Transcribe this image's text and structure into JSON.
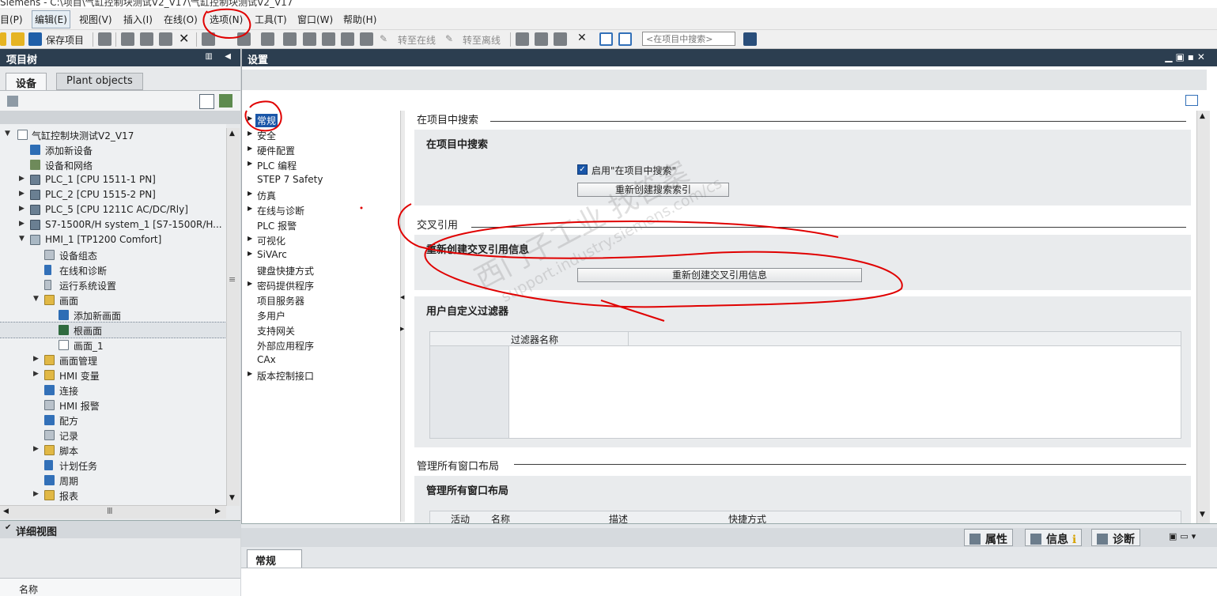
{
  "window": {
    "title": "Siemens - C:\\项目\\气缸控制块测试V2_V17\\气缸控制块测试V2_V17"
  },
  "menu": [
    "目(P)",
    "编辑(E)",
    "视图(V)",
    "插入(I)",
    "在线(O)",
    "选项(N)",
    "工具(T)",
    "窗口(W)",
    "帮助(H)"
  ],
  "toolbar": {
    "save_label": "保存项目",
    "go_online": "转至在线",
    "go_offline": "转至离线",
    "search_placeholder": "<在项目中搜索>"
  },
  "project_tree": {
    "header": "项目树",
    "tabs": [
      "设备",
      "Plant objects"
    ],
    "items": [
      "气缸控制块测试V2_V17",
      "添加新设备",
      "设备和网络",
      "PLC_1 [CPU 1511-1 PN]",
      "PLC_2 [CPU 1515-2 PN]",
      "PLC_5 [CPU 1211C AC/DC/Rly]",
      "S7-1500R/H system_1 [S7-1500R/H...",
      "HMI_1 [TP1200 Comfort]",
      "设备组态",
      "在线和诊断",
      "运行系统设置",
      "画面",
      "添加新画面",
      "根画面",
      "画面_1",
      "画面管理",
      "HMI 变量",
      "连接",
      "HMI 报警",
      "配方",
      "记录",
      "脚本",
      "计划任务",
      "周期",
      "报表"
    ]
  },
  "detail_view": {
    "header": "详细视图",
    "column": "名称"
  },
  "settings": {
    "header": "设置",
    "nav": [
      "常规",
      "安全",
      "硬件配置",
      "PLC 编程",
      "STEP 7 Safety",
      "仿真",
      "在线与诊断",
      "PLC 报警",
      "可视化",
      "SiVArc",
      "键盘快捷方式",
      "密码提供程序",
      "项目服务器",
      "多用户",
      "支持网关",
      "外部应用程序",
      "CAx",
      "版本控制接口"
    ],
    "search_section": {
      "title": "在项目中搜索",
      "box_title": "在项目中搜索",
      "checkbox_label": "启用\"在项目中搜索\"",
      "button": "重新创建搜索索引"
    },
    "xref_section": {
      "title": "交叉引用",
      "box_title": "重新创建交叉引用信息",
      "button": "重新创建交叉引用信息"
    },
    "filter_section": {
      "box_title": "用户自定义过滤器",
      "column": "过滤器名称"
    },
    "layout_section": {
      "title": "管理所有窗口布局",
      "box_title": "管理所有窗口布局",
      "columns": [
        "活动",
        "名称",
        "描述",
        "快捷方式"
      ]
    }
  },
  "properties": {
    "tabs": [
      "属性",
      "信息",
      "诊断"
    ],
    "general_tab": "常规"
  },
  "watermark": {
    "line1": "西门子工业 找答案",
    "line2": "support.industry.siemens.com/cs"
  },
  "colors": {
    "header_bg": "#2c3e50",
    "accent": "#1a56a8",
    "annotation": "#e00000"
  }
}
